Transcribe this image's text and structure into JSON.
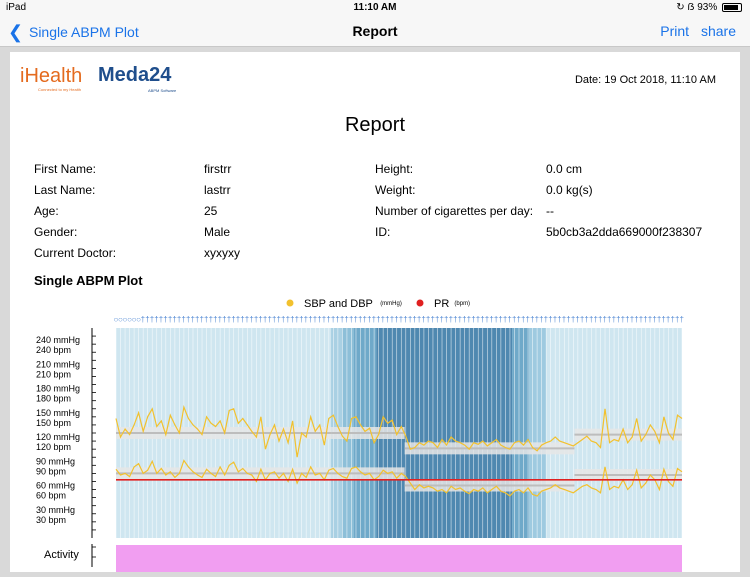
{
  "status": {
    "carrier": "iPad",
    "time": "11:10 AM",
    "battery": "93%"
  },
  "nav": {
    "back_label": "Single ABPM Plot",
    "title": "Report",
    "print_label": "Print",
    "share_label": "share"
  },
  "logos": {
    "ihealth": "iHealth",
    "ihealth_tagline": "Connected to my Health",
    "meda": "Meda24",
    "meda_tagline": "ABPM Software"
  },
  "report": {
    "date": "Date: 19 Oct 2018, 11:10 AM",
    "title": "Report",
    "fields": [
      {
        "label": "First Name:",
        "value": "firstrr"
      },
      {
        "label": "Last Name:",
        "value": "lastrr"
      },
      {
        "label": "Age:",
        "value": "25"
      },
      {
        "label": "Gender:",
        "value": "Male"
      },
      {
        "label": "Current Doctor:",
        "value": "xyxyxy"
      }
    ],
    "fields_right": [
      {
        "label": "Height:",
        "value": "0.0 cm"
      },
      {
        "label": "Weight:",
        "value": "0.0 kg(s)"
      },
      {
        "label": "Number of cigarettes per day:",
        "value": "--"
      },
      {
        "label": "ID:",
        "value": "5b0cb3a2dda669000f238307"
      }
    ],
    "section_title": "Single ABPM Plot"
  },
  "chart_data": {
    "type": "line",
    "legend": [
      {
        "name": "SBP and DBP",
        "unit": "(mmHg)",
        "color": "#f2c12e"
      },
      {
        "name": "PR",
        "unit": "(bpm)",
        "color": "#e02020"
      }
    ],
    "y_ticks": [
      {
        "value": 240,
        "labels": [
          "240  mmHg",
          "240  bpm"
        ]
      },
      {
        "value": 210,
        "labels": [
          "210  mmHg",
          "210  bpm"
        ]
      },
      {
        "value": 180,
        "labels": [
          "180  mmHg",
          "180  bpm"
        ]
      },
      {
        "value": 150,
        "labels": [
          "150  mmHg",
          "150  bpm"
        ]
      },
      {
        "value": 120,
        "labels": [
          "120  mmHg",
          "120  bpm"
        ]
      },
      {
        "value": 90,
        "labels": [
          "90  mmHg",
          "90  bpm"
        ]
      },
      {
        "value": 60,
        "labels": [
          "60  mmHg",
          "60  bpm"
        ]
      },
      {
        "value": 30,
        "labels": [
          "30  mmHg",
          "30  bpm"
        ]
      }
    ],
    "ylim": [
      0,
      260
    ],
    "activity_label": "Activity",
    "bands": [
      {
        "from": 0.38,
        "to": 0.4,
        "color": "#a9d0e3"
      },
      {
        "from": 0.4,
        "to": 0.42,
        "color": "#8dbfd8"
      },
      {
        "from": 0.42,
        "to": 0.46,
        "color": "#6fa9c9"
      },
      {
        "from": 0.46,
        "to": 0.7,
        "color": "#4f88b0"
      },
      {
        "from": 0.7,
        "to": 0.73,
        "color": "#6fa9c9"
      },
      {
        "from": 0.73,
        "to": 0.76,
        "color": "#9ecae0"
      }
    ],
    "sbp_ref": {
      "day": 130,
      "night": 111,
      "day2": 128
    },
    "dbp_ref": {
      "day": 80,
      "night": 65,
      "day2": 78
    },
    "pr_level": 72,
    "systolic": [
      148,
      125,
      135,
      128,
      140,
      155,
      132,
      150,
      160,
      138,
      145,
      128,
      152,
      140,
      130,
      162,
      148,
      140,
      135,
      128,
      150,
      142,
      138,
      145,
      130,
      158,
      160,
      142,
      148,
      140,
      132,
      125,
      150,
      110,
      128,
      140,
      120,
      135,
      118,
      145,
      100,
      130,
      125,
      150,
      132,
      140,
      115,
      148,
      152,
      138,
      126,
      120,
      148,
      150,
      140,
      132,
      136,
      118,
      128,
      150,
      142,
      146,
      128,
      138,
      126,
      110,
      112,
      118,
      115,
      120,
      118,
      112,
      122,
      115,
      125,
      120,
      118,
      115,
      110,
      118,
      116,
      120,
      114,
      118,
      122,
      115,
      112,
      110,
      118,
      120,
      115,
      122,
      112,
      108,
      115,
      118,
      120,
      125,
      120,
      118,
      116,
      114,
      118,
      122,
      126,
      120,
      118,
      112,
      160,
      118,
      122,
      120,
      135,
      118,
      125,
      148,
      120,
      128,
      140,
      132,
      118,
      150,
      130,
      122,
      152,
      148
    ],
    "diastolic": [
      85,
      78,
      80,
      76,
      88,
      92,
      80,
      84,
      95,
      80,
      86,
      78,
      82,
      75,
      80,
      96,
      88,
      82,
      78,
      75,
      85,
      80,
      76,
      88,
      78,
      90,
      94,
      82,
      86,
      80,
      78,
      70,
      85,
      72,
      80,
      82,
      74,
      80,
      70,
      85,
      68,
      80,
      75,
      88,
      78,
      80,
      72,
      84,
      86,
      80,
      76,
      74,
      86,
      88,
      82,
      78,
      80,
      72,
      76,
      84,
      80,
      82,
      74,
      80,
      76,
      68,
      60,
      66,
      62,
      64,
      62,
      58,
      60,
      56,
      64,
      60,
      62,
      58,
      55,
      60,
      58,
      62,
      56,
      60,
      64,
      58,
      56,
      52,
      58,
      60,
      56,
      62,
      54,
      52,
      58,
      60,
      62,
      66,
      62,
      60,
      58,
      56,
      60,
      64,
      66,
      62,
      60,
      56,
      88,
      60,
      64,
      62,
      72,
      60,
      66,
      84,
      62,
      68,
      78,
      72,
      60,
      85,
      70,
      64,
      86,
      82
    ]
  }
}
